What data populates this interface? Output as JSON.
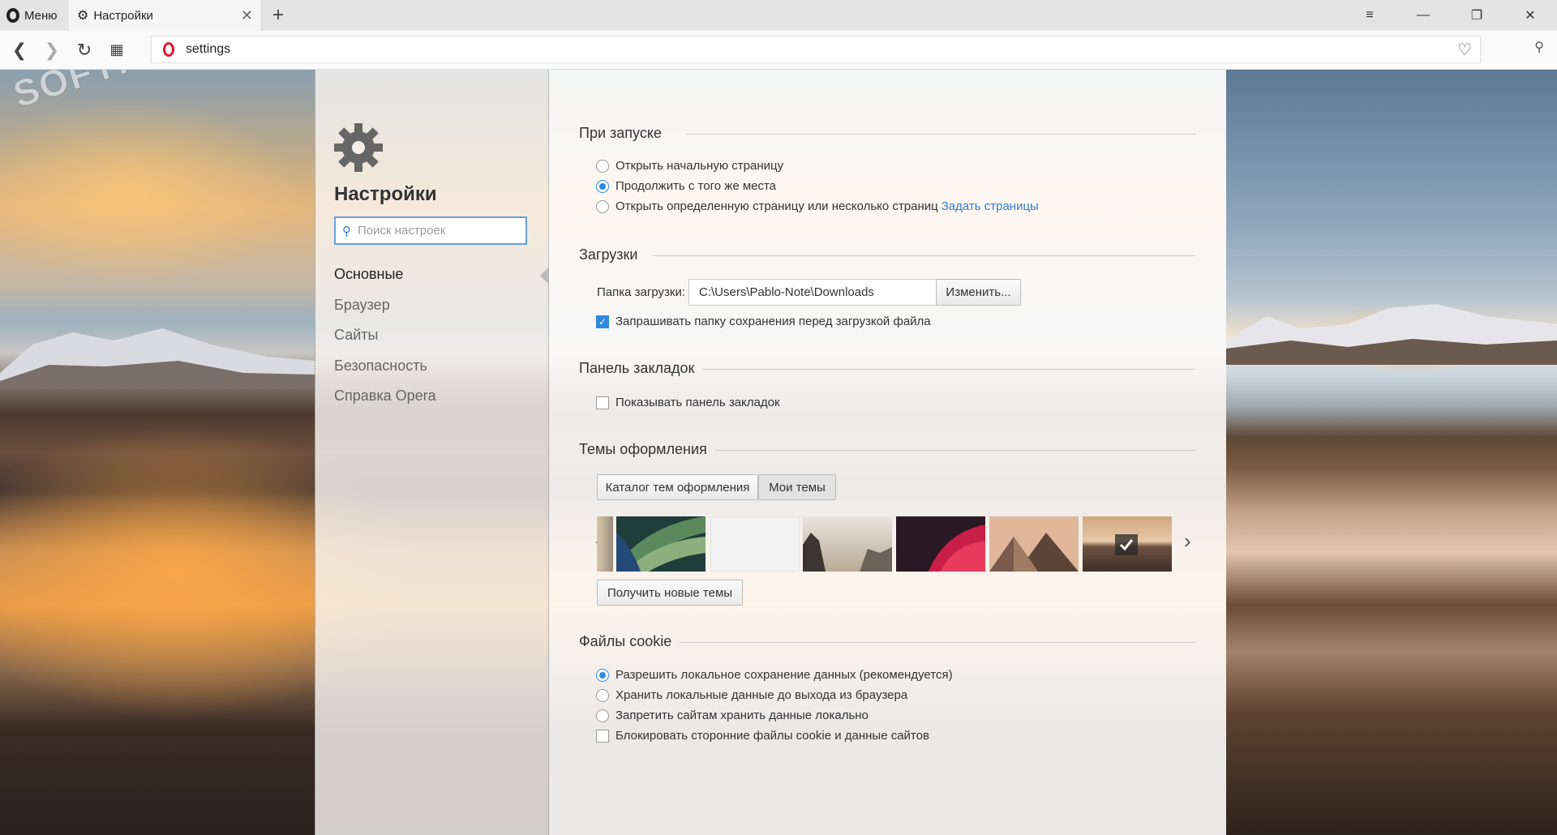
{
  "tabbar": {
    "menu_label": "Меню",
    "tab_title": "Настройки",
    "new_tab": "+",
    "close_tab": "✕",
    "window_minimize": "—",
    "window_restore": "❐",
    "window_close": "✕",
    "tabs_menu": "≡"
  },
  "address": {
    "url": "settings"
  },
  "watermark": "SOFTPORTAL",
  "sidebar": {
    "title": "Настройки",
    "search_placeholder": "Поиск настроек",
    "items": [
      {
        "label": "Основные",
        "active": true
      },
      {
        "label": "Браузер",
        "active": false
      },
      {
        "label": "Сайты",
        "active": false
      },
      {
        "label": "Безопасность",
        "active": false
      },
      {
        "label": "Справка Opera",
        "active": false
      }
    ]
  },
  "startup": {
    "title": "При запуске",
    "options": [
      {
        "label": "Открыть начальную страницу",
        "checked": false
      },
      {
        "label": "Продолжить с того же места",
        "checked": true
      },
      {
        "label": "Открыть определенную страницу или несколько страниц",
        "checked": false
      }
    ],
    "set_pages_link": "Задать страницы"
  },
  "downloads": {
    "title": "Загрузки",
    "folder_label": "Папка загрузки:",
    "folder_value": "C:\\Users\\Pablo-Note\\Downloads",
    "change_button": "Изменить...",
    "ask_label": "Запрашивать папку сохранения перед загрузкой файла",
    "ask_checked": true
  },
  "bookmarks": {
    "title": "Панель закладок",
    "show_label": "Показывать панель закладок",
    "show_checked": false
  },
  "themes": {
    "title": "Темы оформления",
    "tab_catalog": "Каталог тем оформления",
    "tab_my": "Мои темы",
    "get_new": "Получить новые темы",
    "selected_index": 5
  },
  "cookies": {
    "title": "Файлы cookie",
    "options": [
      {
        "label": "Разрешить локальное сохранение данных (рекомендуется)",
        "checked": true
      },
      {
        "label": "Хранить локальные данные до выхода из браузера",
        "checked": false
      },
      {
        "label": "Запретить сайтам хранить данные локально",
        "checked": false
      }
    ],
    "block_third_party": "Блокировать сторонние файлы cookie и данные сайтов",
    "block_checked": false
  },
  "colors": {
    "accent": "#2f8ae0",
    "link": "#2f7ad0",
    "opera_red": "#e0182c"
  }
}
